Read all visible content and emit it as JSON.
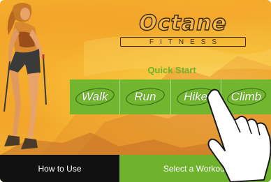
{
  "brand": {
    "name": "Octane",
    "subname": "FITNESS"
  },
  "quick_start": {
    "title": "Quick Start",
    "options": [
      {
        "label": "Walk"
      },
      {
        "label": "Run"
      },
      {
        "label": "Hike"
      },
      {
        "label": "Climb"
      }
    ]
  },
  "bottom_bar": {
    "how_to_use": "How to Use",
    "select_workout": "Select a Workout"
  },
  "colors": {
    "accent_green": "#72b52e",
    "background_orange": "#f5a92c",
    "dark_bar": "#111111"
  },
  "icons": {
    "pointer_hand": "hand-pointer-icon",
    "hiker_photo": "hiker-photo"
  }
}
